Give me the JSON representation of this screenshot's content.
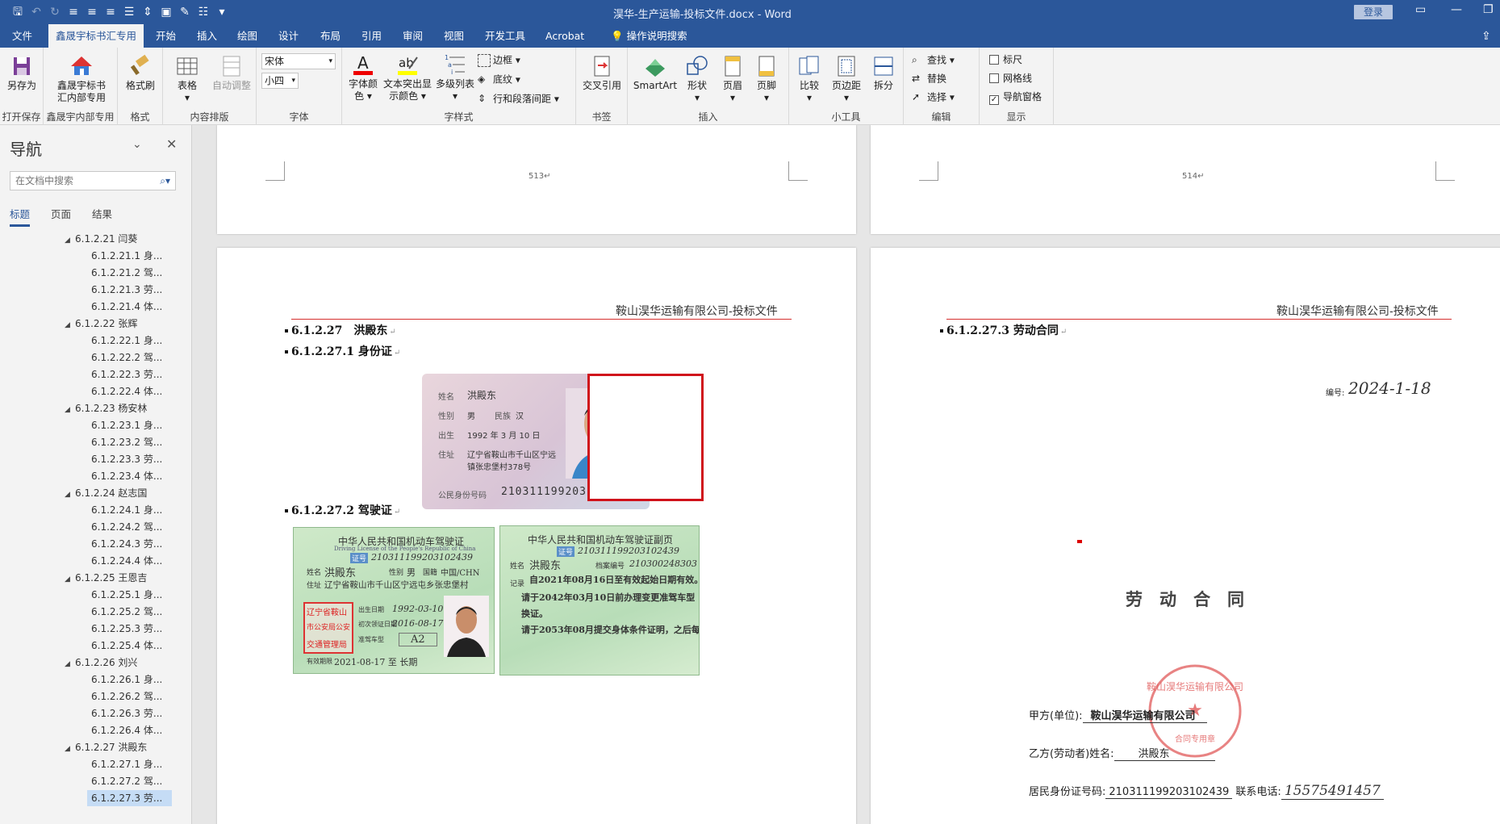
{
  "window": {
    "title": "淏华-生产运输-投标文件.docx - Word",
    "login": "登录"
  },
  "tabs": [
    "文件",
    "鑫晟宇标书汇专用",
    "开始",
    "插入",
    "绘图",
    "设计",
    "布局",
    "引用",
    "审阅",
    "视图",
    "开发工具",
    "Acrobat",
    "操作说明搜索"
  ],
  "ribbon": {
    "groups": {
      "g1": "打开保存",
      "g2": "鑫晟宇内部专用",
      "g3": "格式",
      "g4": "内容排版",
      "g5": "字体",
      "g6": "字样式",
      "g7": "书签",
      "g8": "插入",
      "g9": "小工具",
      "g10": "编辑",
      "g11": "显示"
    },
    "saveas": "另存为",
    "xsy1": "鑫晟宇标书",
    "xsy2": "汇内部专用",
    "fmtpainter": "格式刷",
    "table": "表格",
    "autoadjust": "自动调整",
    "font": "宋体",
    "size": "小四",
    "fontcolor1": "字体颜",
    "fontcolor2": "色",
    "highlight1": "文本突出显",
    "highlight2": "示颜色",
    "multilist": "多级列表",
    "border": "边框",
    "shading": "底纹",
    "spacing": "行和段落间距",
    "crossref": "交叉引用",
    "smartart": "SmartArt",
    "shape": "形状",
    "header": "页眉",
    "footer": "页脚",
    "compare": "比较",
    "margins": "页边距",
    "split": "拆分",
    "find": "查找",
    "replace": "替换",
    "select": "选择",
    "ruler": "标尺",
    "gridlines": "网格线",
    "navpane": "导航窗格"
  },
  "nav": {
    "title": "导航",
    "search_placeholder": "在文档中搜索",
    "tabs": [
      "标题",
      "页面",
      "结果"
    ],
    "items": [
      {
        "t": "6.1.2.21 闫葵",
        "l": 1
      },
      {
        "t": "6.1.2.21.1 身...",
        "l": 2
      },
      {
        "t": "6.1.2.21.2 驾...",
        "l": 2
      },
      {
        "t": "6.1.2.21.3 劳...",
        "l": 2
      },
      {
        "t": "6.1.2.21.4 体...",
        "l": 2
      },
      {
        "t": "6.1.2.22 张辉",
        "l": 1
      },
      {
        "t": "6.1.2.22.1 身...",
        "l": 2
      },
      {
        "t": "6.1.2.22.2 驾...",
        "l": 2
      },
      {
        "t": "6.1.2.22.3 劳...",
        "l": 2
      },
      {
        "t": "6.1.2.22.4 体...",
        "l": 2
      },
      {
        "t": "6.1.2.23 杨安林",
        "l": 1
      },
      {
        "t": "6.1.2.23.1 身...",
        "l": 2
      },
      {
        "t": "6.1.2.23.2 驾...",
        "l": 2
      },
      {
        "t": "6.1.2.23.3 劳...",
        "l": 2
      },
      {
        "t": "6.1.2.23.4 体...",
        "l": 2
      },
      {
        "t": "6.1.2.24 赵志国",
        "l": 1
      },
      {
        "t": "6.1.2.24.1 身...",
        "l": 2
      },
      {
        "t": "6.1.2.24.2 驾...",
        "l": 2
      },
      {
        "t": "6.1.2.24.3 劳...",
        "l": 2
      },
      {
        "t": "6.1.2.24.4 体...",
        "l": 2
      },
      {
        "t": "6.1.2.25 王恩吉",
        "l": 1
      },
      {
        "t": "6.1.2.25.1 身...",
        "l": 2
      },
      {
        "t": "6.1.2.25.2 驾...",
        "l": 2
      },
      {
        "t": "6.1.2.25.3 劳...",
        "l": 2
      },
      {
        "t": "6.1.2.25.4 体...",
        "l": 2
      },
      {
        "t": "6.1.2.26 刘兴",
        "l": 1
      },
      {
        "t": "6.1.2.26.1 身...",
        "l": 2
      },
      {
        "t": "6.1.2.26.2 驾...",
        "l": 2
      },
      {
        "t": "6.1.2.26.3 劳...",
        "l": 2
      },
      {
        "t": "6.1.2.26.4 体...",
        "l": 2
      },
      {
        "t": "6.1.2.27 洪殿东",
        "l": 1
      },
      {
        "t": "6.1.2.27.1 身...",
        "l": 2
      },
      {
        "t": "6.1.2.27.2 驾...",
        "l": 2
      },
      {
        "t": "6.1.2.27.3 劳...",
        "l": 2,
        "sel": true
      }
    ]
  },
  "doc": {
    "pnum_left": "513↵",
    "pnum_right": "514↵",
    "header_text": "鞍山淏华运输有限公司-投标文件",
    "h1": "6.1.2.27　洪殿东",
    "h2": "6.1.2.27.1 身份证",
    "h3": "6.1.2.27.2 驾驶证",
    "h4": "6.1.2.27.3 劳动合同",
    "para_mark": "↵",
    "id": {
      "name_label": "姓名",
      "name": "洪殿东",
      "sex_label": "性别",
      "sex": "男",
      "nation_label": "民族",
      "nation": "汉",
      "birth_label": "出生",
      "birth": "1992 年 3 月 10 日",
      "addr_label": "住址",
      "addr1": "辽宁省鞍山市千山区宁远",
      "addr2": "镇张忠堡村378号",
      "num_label": "公民身份号码",
      "num": "210311199203102439"
    },
    "lic": {
      "title": "中华人民共和国机动车驾驶证",
      "title_en": "Driving License of the People's Republic of China",
      "cert_label": "证号",
      "num": "210311199203102439",
      "name_label": "姓名",
      "name": "洪殿东",
      "sex_label": "性别",
      "sex": "男",
      "nat_label": "国籍",
      "nat": "中国/CHN",
      "addr_label": "住址",
      "addr": "辽宁省鞍山市千山区宁远屯乡张忠堡村",
      "stamp1": "辽宁省鞍山",
      "stamp2": "市公安局公安",
      "stamp3": "交通管理局",
      "birth_label": "出生日期",
      "birth": "1992-03-10",
      "first_label": "初次领证日期",
      "first": "2016-08-17",
      "class_label": "准驾车型",
      "class": "A2",
      "valid_label": "有效期限",
      "valid": "2021-08-17 至 长期",
      "sub_title": "中华人民共和国机动车驾驶证副页",
      "sub_num": "210311199203102439",
      "sub_name": "洪殿东",
      "sub_file_label": "档案编号",
      "sub_file": "210300248303",
      "sub_record_label": "记录",
      "sub_l1": "自2021年08月16日至有效起始日期有效。",
      "sub_l2": "请于2042年03月10日前办理变更准驾车型",
      "sub_l3": "换证。",
      "sub_l4": "请于2053年08月提交身体条件证明，之后每"
    },
    "contract": {
      "no_label": "编号:",
      "no_value": "2024-1-18",
      "title": "劳　动　合　同",
      "party_a_label": "甲方(单位):",
      "party_a": "鞍山淏华运输有限公司",
      "seal_text": "鞍山淏华运输有限公司",
      "seal_sub": "合同专用章",
      "party_b_label": "乙方(劳动者)姓名:",
      "party_b": "洪殿东",
      "idno_label": "居民身份证号码:",
      "idno": "210311199203102439",
      "phone_label": "联系电话:",
      "phone": "15575491457"
    }
  }
}
